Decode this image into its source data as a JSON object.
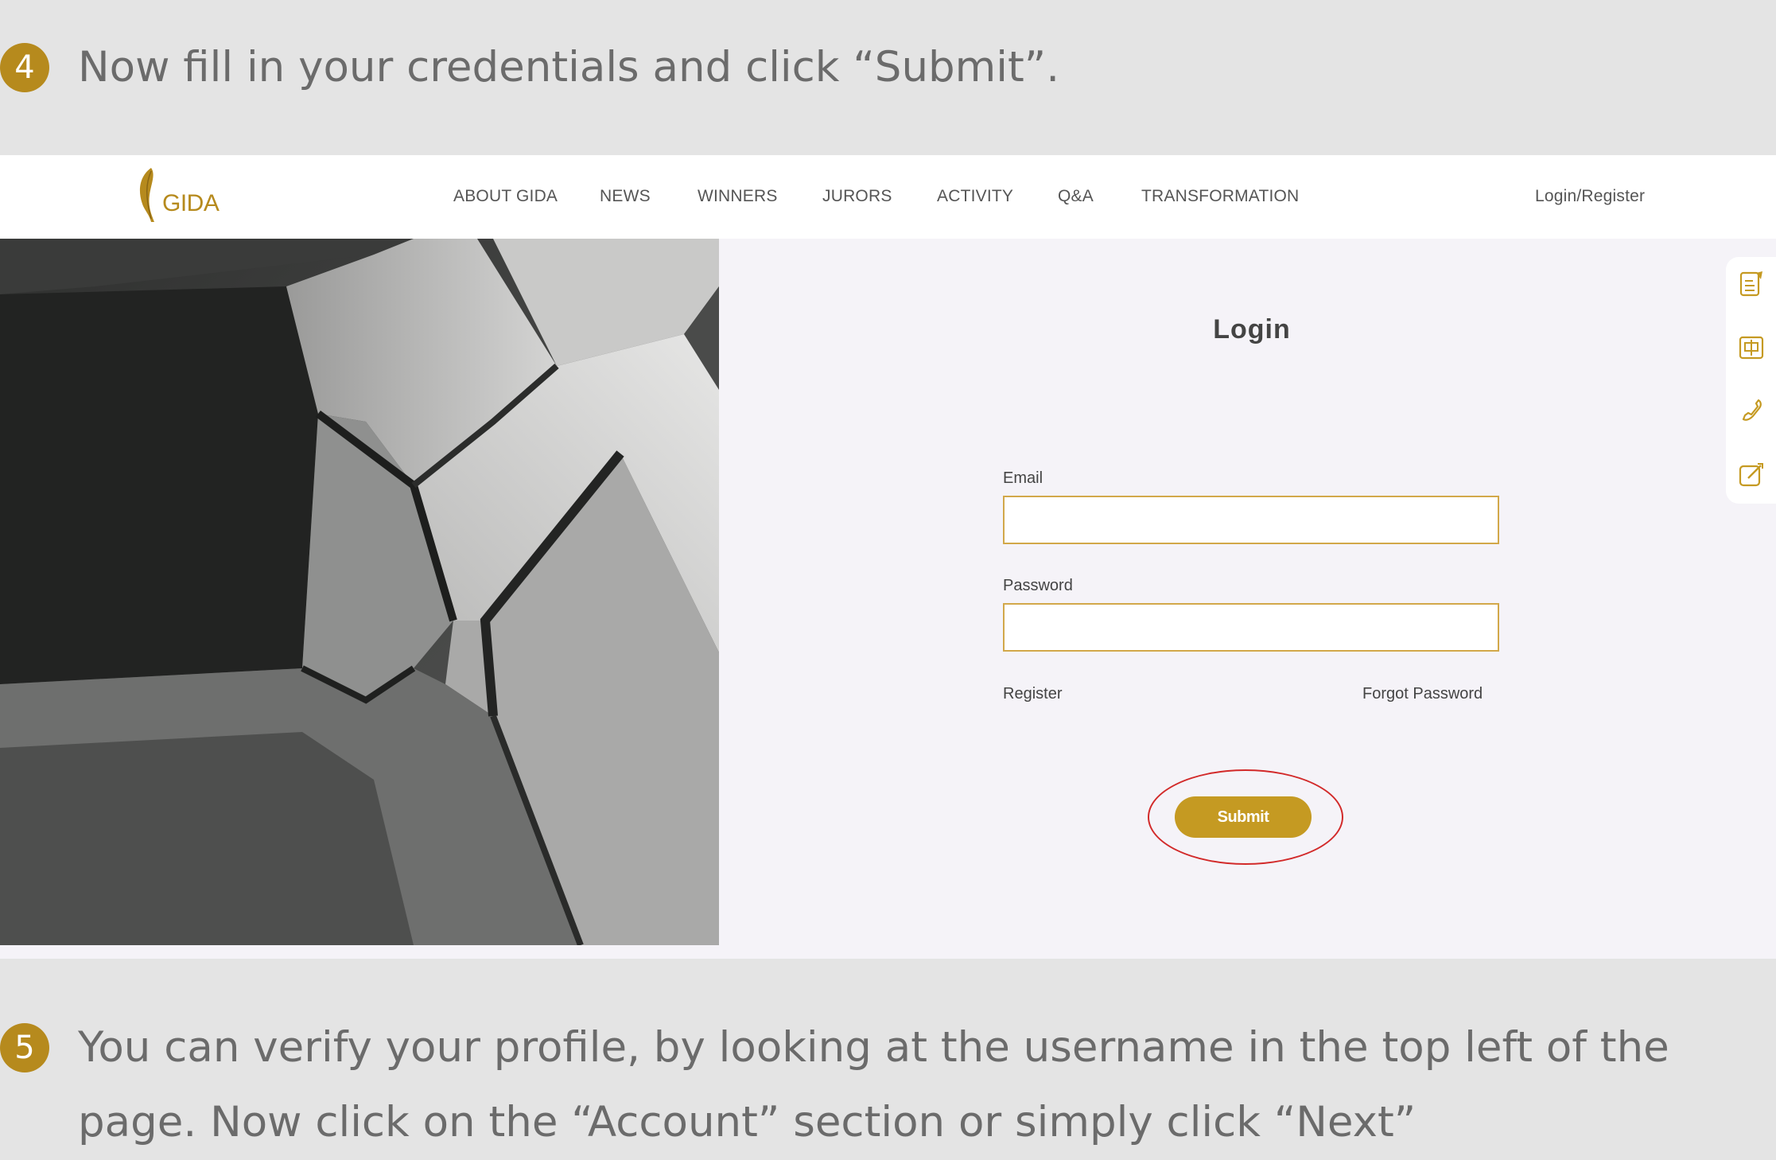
{
  "tutorial": {
    "step4": {
      "number": "4",
      "text": "Now fill in your credentials and click “Submit”."
    },
    "step5": {
      "number": "5",
      "text": "You can verify your profile, by looking at the username in the top left of the page. Now click on the “Account” section or simply click “Next”"
    }
  },
  "site": {
    "logo_text": "GIDA",
    "nav": {
      "items": [
        "ABOUT GIDA",
        "NEWS",
        "WINNERS",
        "JURORS",
        "ACTIVITY",
        "Q&A",
        "TRANSFORMATION"
      ],
      "login_register": "Login/Register"
    },
    "login": {
      "title": "Login",
      "email_label": "Email",
      "email_value": "",
      "password_label": "Password",
      "password_value": "",
      "register_link": "Register",
      "forgot_link": "Forgot Password",
      "submit_label": "Submit"
    },
    "side_tools": [
      "register-form-icon",
      "chinese-language-icon",
      "phone-icon",
      "edit-icon"
    ]
  },
  "colors": {
    "accent": "#c59a22",
    "step_badge": "#b68a1d",
    "input_border": "#d2a84a",
    "highlight": "#d22a2a",
    "page_bg": "#e4e4e4",
    "screen_bg": "#f5f3f8"
  }
}
